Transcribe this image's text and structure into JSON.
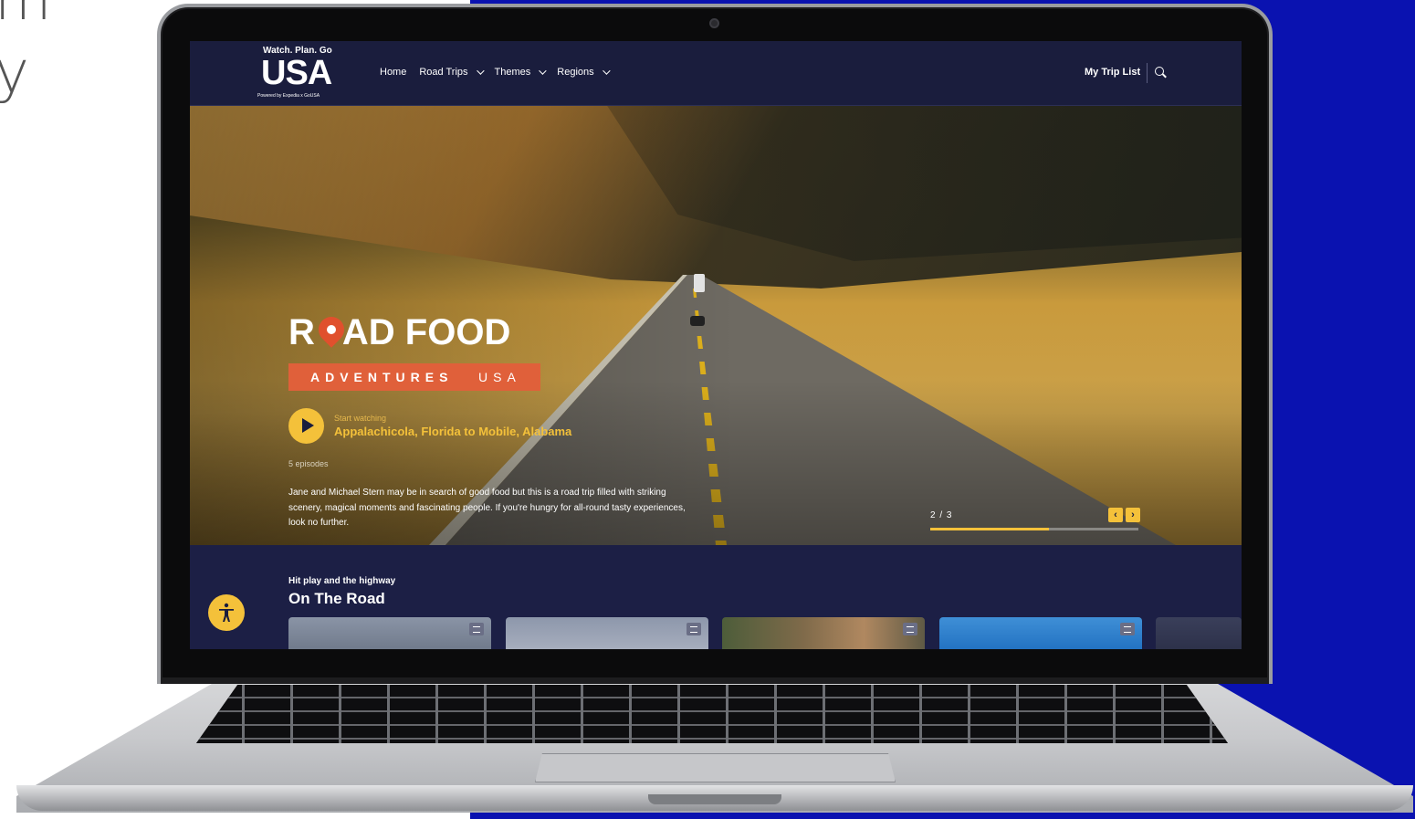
{
  "backdrop": {
    "partial_text_lines": [
      "m",
      "y"
    ]
  },
  "site": {
    "logo_tagline": "Watch. Plan. Go",
    "logo_wordmark": "USA",
    "logo_sub": "Powered by Expedia x GoUSA",
    "nav": [
      "Home",
      "Road Trips",
      "Themes",
      "Regions"
    ],
    "nav_dropdowns": [
      false,
      true,
      true,
      true
    ],
    "my_trip_list": "My Trip List"
  },
  "hero": {
    "show_title_a": "R",
    "show_title_b": "AD FOOD",
    "subtitle_a": "ADVENTURES",
    "subtitle_b": "USA",
    "start_watching_label": "Start watching",
    "episode_title": "Appalachicola, Florida to Mobile, Alabama",
    "episode_count": "5 episodes",
    "description": "Jane and Michael Stern may be in search of good food but this is a road trip filled with striking scenery, magical moments and fascinating people. If you're hungry for all-round tasty experiences, look no further.",
    "pager": "2 / 3",
    "progress": 0.57,
    "prev_label": "‹",
    "next_label": "›"
  },
  "section": {
    "kicker": "Hit play and the highway",
    "title": "On The Road"
  },
  "colors": {
    "accent": "#f4c13a",
    "header": "#1a1d3d",
    "band": "#e0603a",
    "backdrop": "#0a12b0"
  }
}
